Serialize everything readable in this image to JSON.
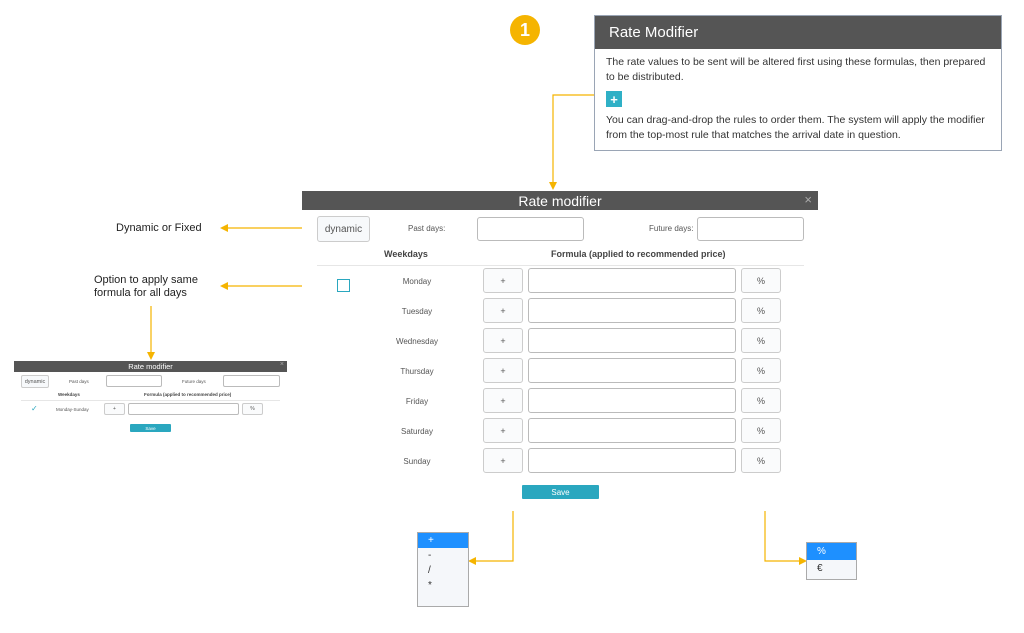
{
  "step_badge": "1",
  "info_panel": {
    "title": "Rate Modifier",
    "text1": "The rate values to be sent will be altered first using these formulas, then prepared to be distributed.",
    "add_label": "+",
    "text2": "You can drag-and-drop the rules to order them. The system will apply the modifier from the top-most rule that matches the arrival date in question."
  },
  "annotations": {
    "dynamic_or_fixed": "Dynamic or Fixed",
    "apply_same": "Option to apply same formula for all days"
  },
  "modal": {
    "title": "Rate modifier",
    "close": "×",
    "mode_button": "dynamic",
    "past_days_label": "Past days:",
    "future_days_label": "Future days:",
    "col_weekdays": "Weekdays",
    "col_formula": "Formula (applied to recommended price)",
    "rows": [
      {
        "day": "Monday",
        "op": "+",
        "unit": "%"
      },
      {
        "day": "Tuesday",
        "op": "+",
        "unit": "%"
      },
      {
        "day": "Wednesday",
        "op": "+",
        "unit": "%"
      },
      {
        "day": "Thursday",
        "op": "+",
        "unit": "%"
      },
      {
        "day": "Friday",
        "op": "+",
        "unit": "%"
      },
      {
        "day": "Saturday",
        "op": "+",
        "unit": "%"
      },
      {
        "day": "Sunday",
        "op": "+",
        "unit": "%"
      }
    ],
    "save_label": "Save"
  },
  "small_modal": {
    "title": "Rate modifier",
    "close": "×",
    "mode_button": "dynamic",
    "past_days_label": "Past days",
    "future_days_label": "Future days",
    "col_weekdays": "Weekdays",
    "col_formula": "Formula (applied to recommended price)",
    "check": "✓",
    "day_range": "Monday-Sunday",
    "op": "+",
    "unit": "%",
    "save_label": "Save"
  },
  "operator_dropdown": {
    "options": [
      "+",
      "-",
      "/",
      "*"
    ],
    "selected": "+"
  },
  "unit_dropdown": {
    "options": [
      "%",
      "€"
    ],
    "selected": "%"
  },
  "colors": {
    "accent": "#2aa7bf",
    "header": "#555555",
    "arrow": "#f5b400",
    "selected": "#1e90ff"
  }
}
